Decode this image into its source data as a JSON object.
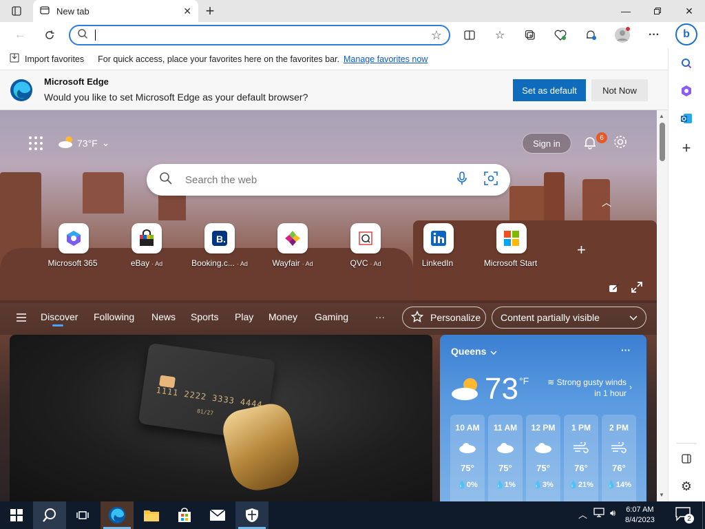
{
  "browser": {
    "tab_title": "New tab",
    "address_value": "",
    "favorites_bar": {
      "import_label": "Import favorites",
      "hint": "For quick access, place your favorites here on the favorites bar.",
      "link": "Manage favorites now"
    },
    "banner": {
      "title": "Microsoft Edge",
      "text": "Would you like to set Microsoft Edge as your default browser?",
      "primary_button": "Set as default",
      "secondary_button": "Not Now"
    }
  },
  "newtab": {
    "weather_mini": "73°F",
    "sign_in": "Sign in",
    "notification_count": "6",
    "search_placeholder": "Search the web",
    "tiles": [
      {
        "label": "Microsoft 365",
        "ad": ""
      },
      {
        "label": "eBay",
        "ad": "· Ad"
      },
      {
        "label": "Booking.c...",
        "ad": "· Ad"
      },
      {
        "label": "Wayfair",
        "ad": "· Ad"
      },
      {
        "label": "QVC",
        "ad": "· Ad"
      },
      {
        "label": "LinkedIn",
        "ad": ""
      },
      {
        "label": "Microsoft Start",
        "ad": ""
      }
    ],
    "nav": [
      "Discover",
      "Following",
      "News",
      "Sports",
      "Play",
      "Money",
      "Gaming",
      "···"
    ],
    "personalize": "Personalize",
    "content_visibility": "Content partially visible",
    "card": {
      "number": "1111 2222 3333 4444",
      "expiry": "01/27"
    }
  },
  "weather": {
    "city": "Queens",
    "temp": "73",
    "unit": "°F",
    "alert": "Strong gusty winds in 1 hour",
    "hours": [
      {
        "time": "10 AM",
        "temp": "75°",
        "precip": "0%"
      },
      {
        "time": "11 AM",
        "temp": "75°",
        "precip": "1%"
      },
      {
        "time": "12 PM",
        "temp": "75°",
        "precip": "3%"
      },
      {
        "time": "1 PM",
        "temp": "76°",
        "precip": "21%"
      },
      {
        "time": "2 PM",
        "temp": "76°",
        "precip": "14%"
      }
    ]
  },
  "taskbar": {
    "time": "6:07 AM",
    "date": "8/4/2023",
    "notifications": "2"
  },
  "colors": {
    "accent": "#0f6cbd",
    "link": "#0a5bc4",
    "weather_bg": "#3b7fd1",
    "badge": "#e35a2b"
  }
}
